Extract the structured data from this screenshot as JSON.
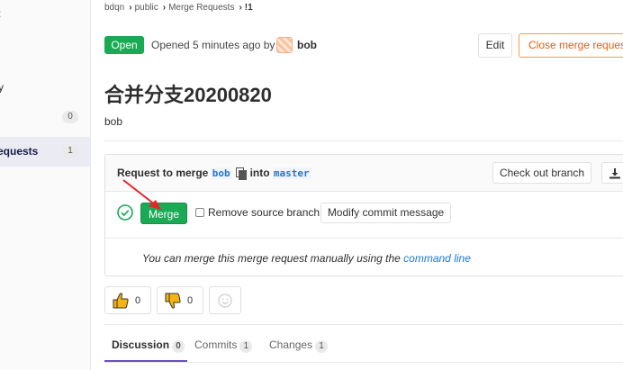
{
  "sidebar": {
    "partial_top": ":",
    "partial_mid": "y",
    "item_count_1": "0",
    "active_label": "equests",
    "active_count": "1"
  },
  "breadcrumb": {
    "project_group": "bdqn",
    "project": "public",
    "section": "Merge Requests",
    "item": "!1"
  },
  "header": {
    "status": "Open",
    "opened_text": "Opened 5 minutes ago by",
    "author": "bob",
    "edit_label": "Edit",
    "close_label": "Close merge request"
  },
  "mr": {
    "title": "合并分支20200820",
    "description": "bob"
  },
  "widget": {
    "request_prefix": "Request to merge",
    "source_branch": "bob",
    "into_label": "into",
    "target_branch": "master",
    "checkout_label": "Check out branch",
    "merge_label": "Merge",
    "remove_source_label": "Remove source branch",
    "modify_commit_label": "Modify commit message",
    "manual_text": "You can merge this merge request manually using the",
    "command_line_link": "command line"
  },
  "awards": {
    "thumbsup_count": "0",
    "thumbsdown_count": "0"
  },
  "tabs": [
    {
      "label": "Discussion",
      "count": "0"
    },
    {
      "label": "Commits",
      "count": "1"
    },
    {
      "label": "Changes",
      "count": "1"
    }
  ],
  "colors": {
    "accent_green": "#1aaa55",
    "close_orange": "#e75e0a",
    "link_blue": "#1f78d1",
    "tab_active": "#6b4fbb",
    "annotation_red": "#e8232a"
  }
}
